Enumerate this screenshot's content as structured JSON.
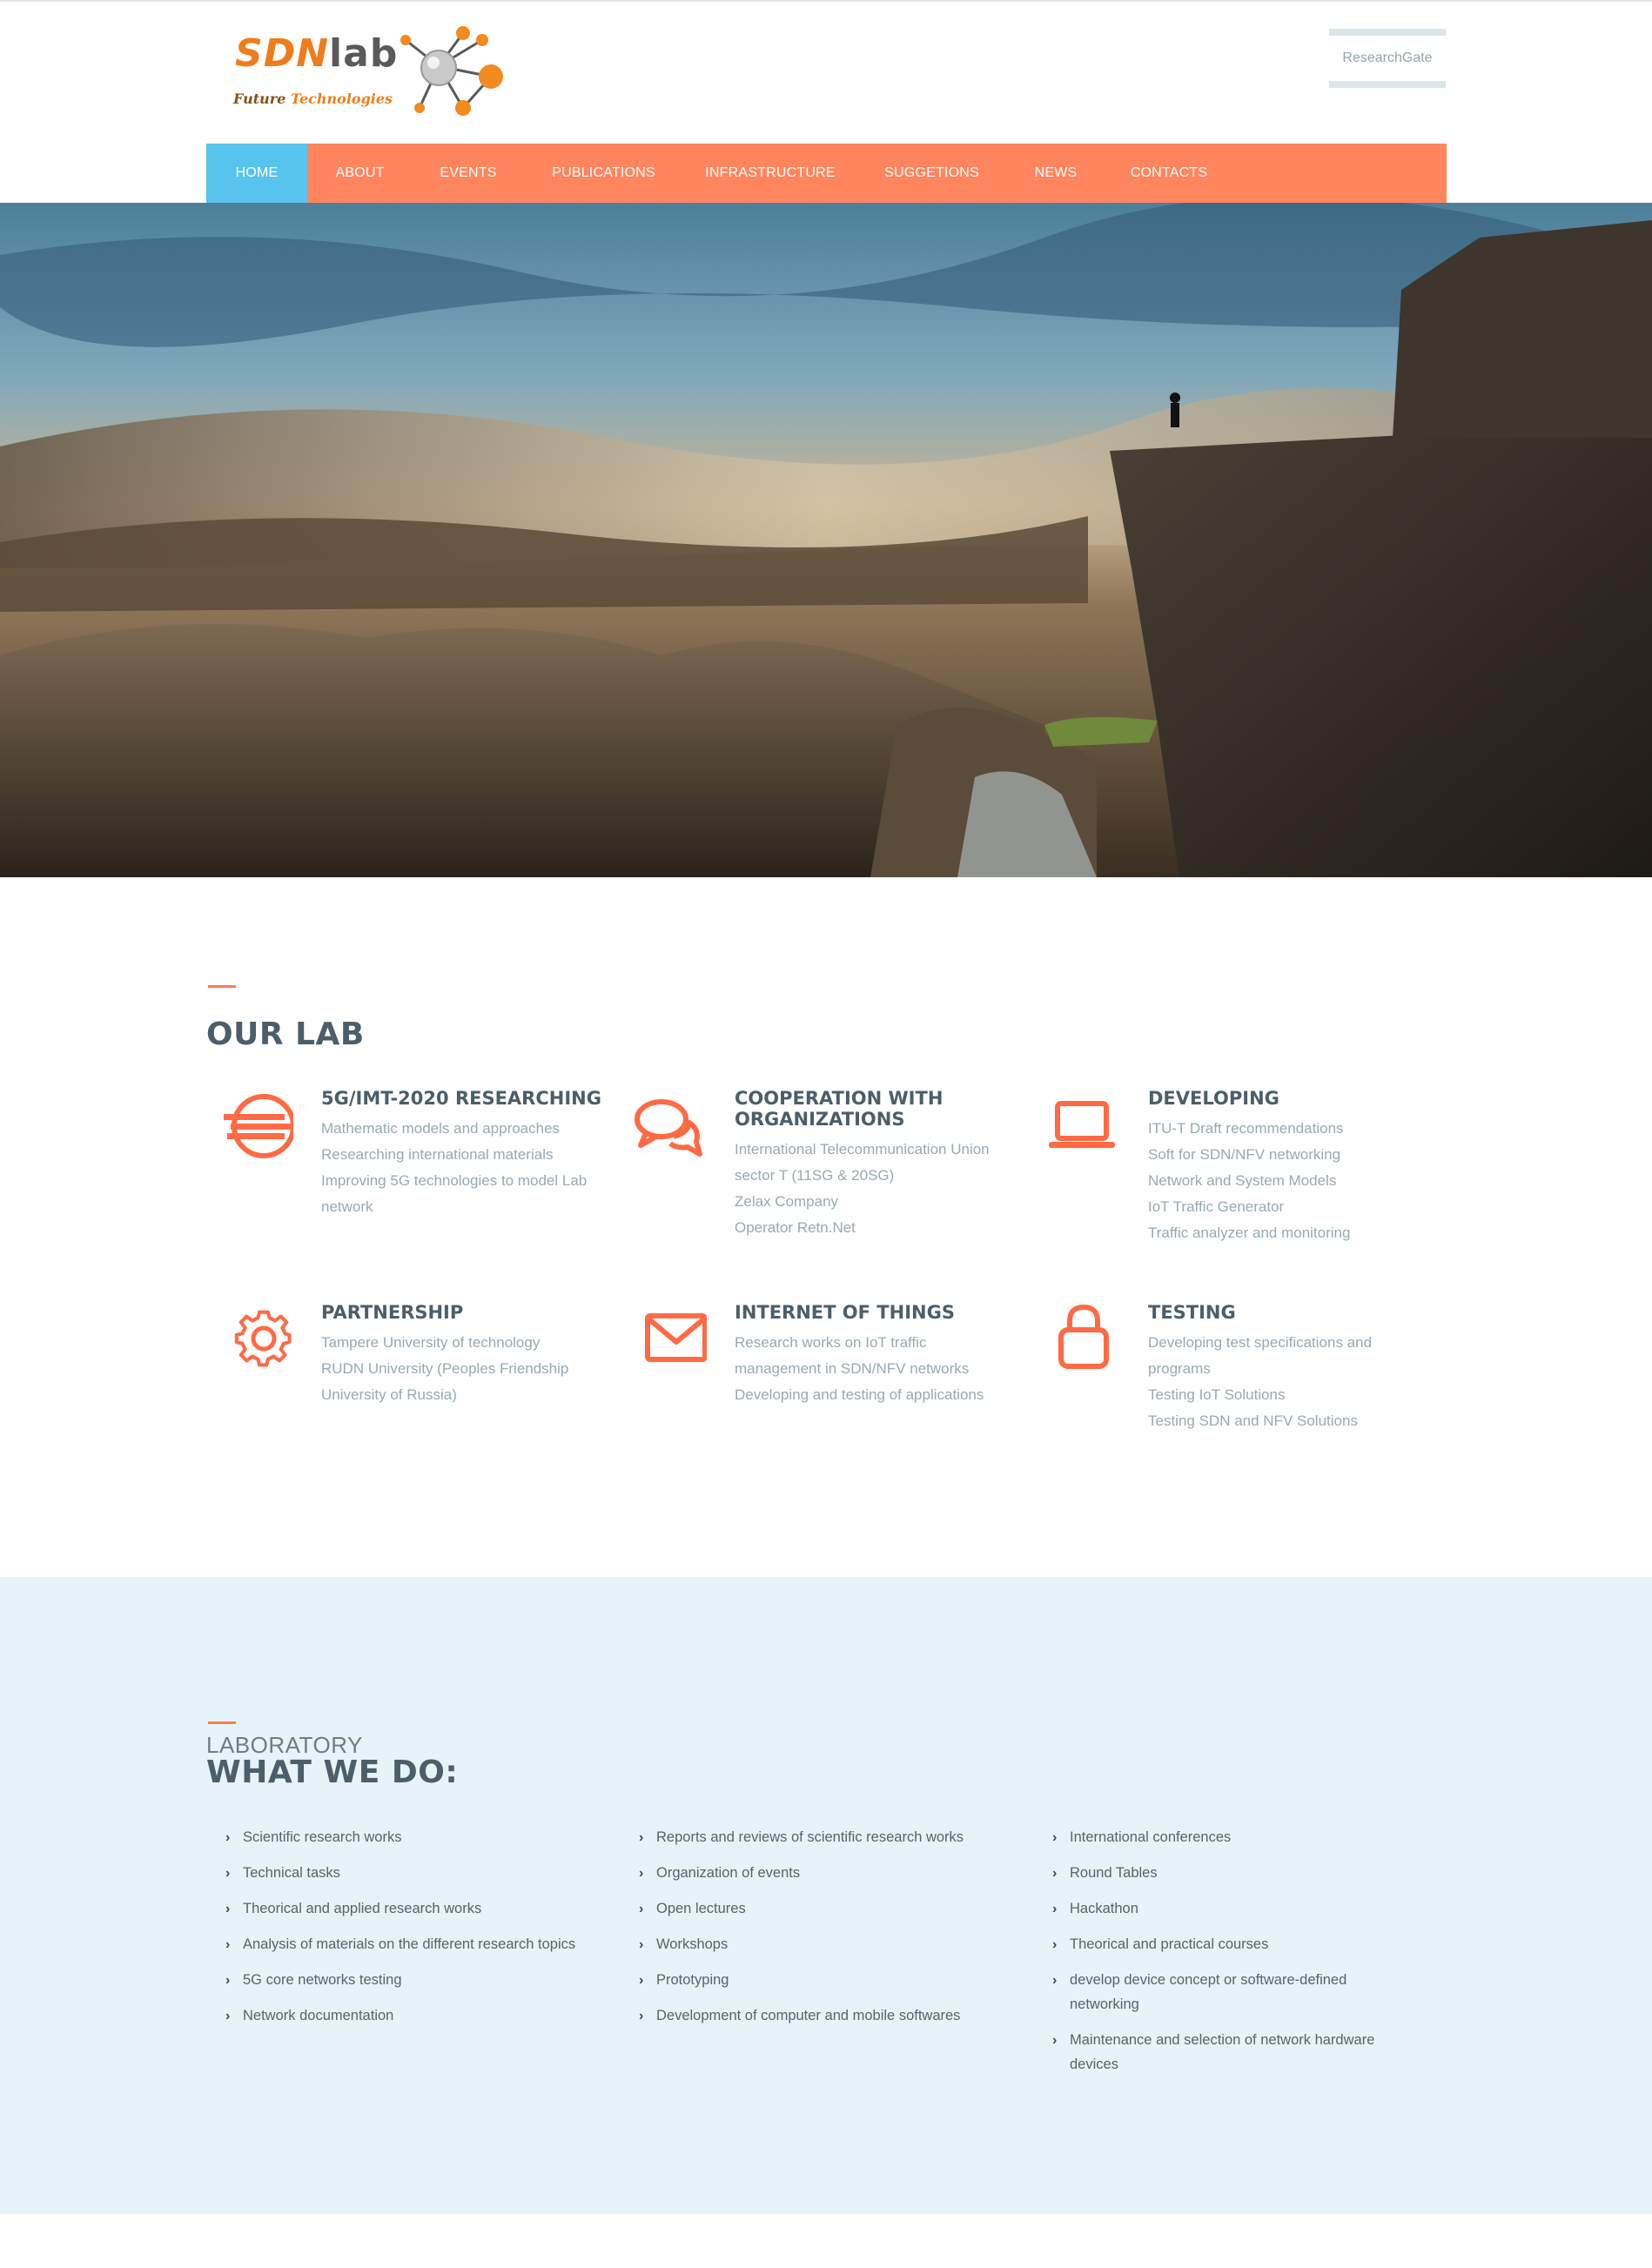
{
  "brand": {
    "logo_main": "SDN",
    "logo_suffix": "lab",
    "logo_tagline_1": "Future",
    "logo_tagline_2": "Technologies",
    "accent_color": "#ff855e",
    "active_color": "#57c4ee",
    "heading_color": "#4b5e6a"
  },
  "header": {
    "research_gate_label": "ResearchGate"
  },
  "nav": {
    "items": [
      {
        "label": "HOME",
        "active": true
      },
      {
        "label": "ABOUT",
        "active": false
      },
      {
        "label": "EVENTS",
        "active": false
      },
      {
        "label": "PUBLICATIONS",
        "active": false
      },
      {
        "label": "INFRASTRUCTURE",
        "active": false
      },
      {
        "label": "SUGGETIONS",
        "active": false
      },
      {
        "label": "NEWS",
        "active": false
      },
      {
        "label": "CONTACTS",
        "active": false
      }
    ]
  },
  "hero": {
    "image": "mountain-cliff-landscape"
  },
  "our_lab": {
    "title": "OUR LAB",
    "features": [
      {
        "icon": "5g-circle-icon",
        "title": "5G/IMT-2020 RESEARCHING",
        "lines": [
          "Mathematic models and approaches",
          "Researching international materials",
          "Improving 5G technologies to model Lab network"
        ]
      },
      {
        "icon": "chat-bubbles-icon",
        "title": "COOPERATION WITH ORGANIZATIONS",
        "lines": [
          "International Telecommunication Union sector T (11SG & 20SG)",
          "Zelax Company",
          "Operator Retn.Net"
        ]
      },
      {
        "icon": "laptop-icon",
        "title": "DEVELOPING",
        "lines": [
          "ITU-T Draft recommendations",
          "Soft for SDN/NFV networking",
          "Network and System Models",
          "IoT Traffic Generator",
          "Traffic analyzer and monitoring"
        ]
      },
      {
        "icon": "gear-icon",
        "title": "PARTNERSHIP",
        "lines": [
          "Tampere University of technology",
          "RUDN University (Peoples Friendship University of Russia)"
        ]
      },
      {
        "icon": "envelope-icon",
        "title": "INTERNET OF THINGS",
        "lines": [
          "Research works on IoT traffic management in SDN/NFV networks",
          "Developing and testing of applications"
        ]
      },
      {
        "icon": "lock-icon",
        "title": "TESTING",
        "lines": [
          "Developing test specifications and programs",
          "Testing IoT Solutions",
          "Testing SDN and NFV Solutions"
        ]
      }
    ]
  },
  "what_we_do": {
    "label": "LABORATORY",
    "title": "WHAT WE DO:",
    "columns": [
      [
        "Scientific research works",
        "Technical tasks",
        "Theorical and applied research works",
        "Analysis of materials on the different research topics",
        "5G core networks testing",
        "Network documentation"
      ],
      [
        "Reports and reviews of scientific research works",
        "Organization of events",
        "Open lectures",
        "Workshops",
        "Prototyping",
        "Development of computer and mobile softwares"
      ],
      [
        "International conferences",
        "Round Tables",
        "Hackathon",
        "Theorical and practical courses",
        "develop device concept or software-defined networking",
        "Maintenance and selection of network hardware devices"
      ]
    ]
  }
}
